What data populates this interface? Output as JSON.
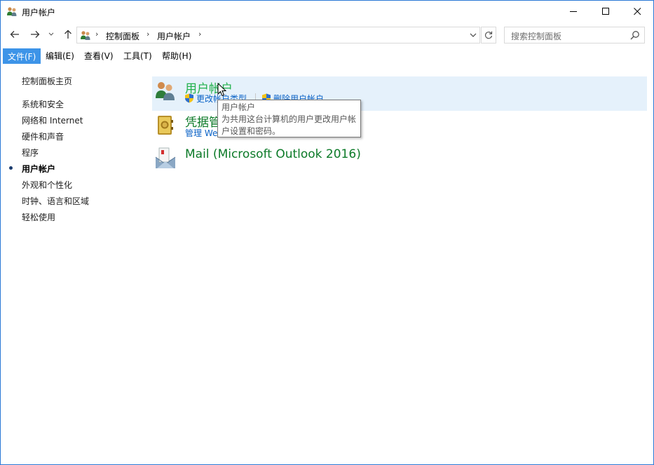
{
  "window": {
    "title": "用户帐户"
  },
  "address": {
    "crumbs": [
      "控制面板",
      "用户帐户"
    ]
  },
  "search": {
    "placeholder": "搜索控制面板"
  },
  "menubar": {
    "items": [
      "文件(F)",
      "编辑(E)",
      "查看(V)",
      "工具(T)",
      "帮助(H)"
    ],
    "underline_keys": [
      "F",
      "E",
      "V",
      "T",
      "H"
    ],
    "active_index": 0
  },
  "sidebar": {
    "home": "控制面板主页",
    "items": [
      {
        "label": "系统和安全",
        "current": false
      },
      {
        "label": "网络和 Internet",
        "current": false
      },
      {
        "label": "硬件和声音",
        "current": false
      },
      {
        "label": "程序",
        "current": false
      },
      {
        "label": "用户帐户",
        "current": true
      },
      {
        "label": "外观和个性化",
        "current": false
      },
      {
        "label": "时钟、语言和区域",
        "current": false
      },
      {
        "label": "轻松使用",
        "current": false
      }
    ]
  },
  "content": {
    "categories": [
      {
        "title": "用户帐户",
        "icon": "user-accounts-icon",
        "links": [
          "更改帐户类型",
          "删除用户帐户"
        ]
      },
      {
        "title": "凭据管理器",
        "icon": "credential-manager-icon",
        "links": [
          "管理 Web 凭据"
        ]
      },
      {
        "title": "Mail (Microsoft Outlook 2016)",
        "icon": "mail-icon",
        "links": []
      }
    ]
  },
  "tooltip": {
    "title": "用户帐户",
    "line1": "为共用这台计算机的用户更改用户帐",
    "line2": "户设置和密码。"
  },
  "colors": {
    "accent": "#3d94e8",
    "link": "#0a62c6",
    "category_title": "#0c7a28",
    "hover_title": "#22b14c",
    "highlight_row": "#e5f1fb",
    "window_border": "#2b79d6"
  }
}
